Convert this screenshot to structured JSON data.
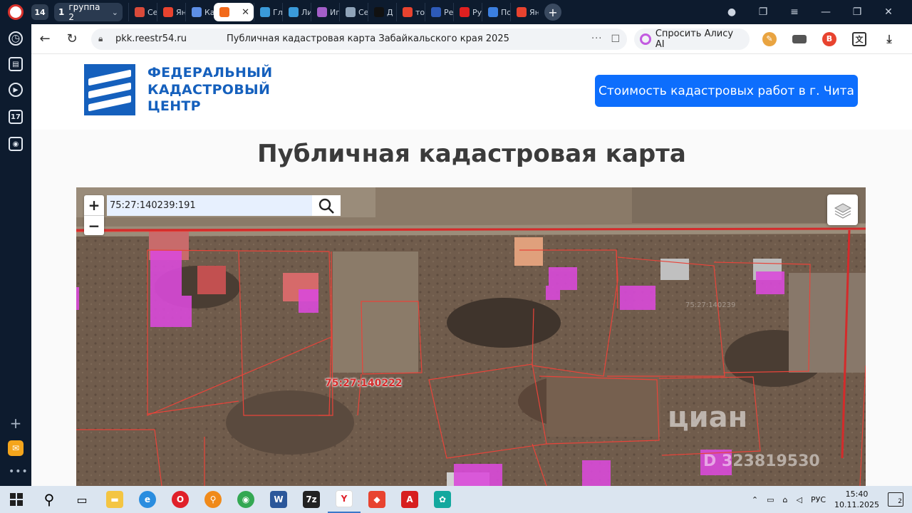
{
  "browser": {
    "tab_count": "14",
    "tab_group": {
      "number": "1",
      "label": "группа 2"
    },
    "tabs": [
      {
        "label": "Се",
        "color": "#d94a3a",
        "icon": "home-icon"
      },
      {
        "label": "Ян",
        "color": "#e8432f",
        "icon": "map-pin-icon"
      },
      {
        "label": "Ка",
        "color": "#5d8fe6",
        "icon": "calc-icon"
      },
      {
        "label": "",
        "color": "#f26a1b",
        "icon": "house-icon",
        "active": true
      },
      {
        "label": "Гл",
        "color": "#3a9ad9",
        "icon": "site-icon"
      },
      {
        "label": "Ли",
        "color": "#3a9ad9",
        "icon": "site-icon"
      },
      {
        "label": "Ип",
        "color": "#a35ec8",
        "icon": "grid-icon"
      },
      {
        "label": "Се",
        "color": "#8fa3b8",
        "icon": "doc-icon"
      },
      {
        "label": "Д",
        "color": "#111111",
        "icon": "star-icon"
      },
      {
        "label": "то",
        "color": "#e8432f",
        "icon": "yandex-icon"
      },
      {
        "label": "Ре",
        "color": "#2d5ab8",
        "icon": "gov-icon"
      },
      {
        "label": "Ру",
        "color": "#e02020",
        "icon": "play-icon"
      },
      {
        "label": "По",
        "color": "#3b7fe0",
        "icon": "mail-icon"
      },
      {
        "label": "Ян",
        "color": "#e8432f",
        "icon": "map-pin-icon"
      }
    ],
    "url_domain": "pkk.reestr54.ru",
    "page_title": "Публичная кадастровая карта Забайкальского края 2025",
    "alice_label": "Спросить Алису AI"
  },
  "site": {
    "logo_lines": [
      "ФЕДЕРАЛЬНЫЙ",
      "КАДАСТРОВЫЙ",
      "ЦЕНТР"
    ],
    "cta_label": "Стоимость кадастровых работ в г. Чита",
    "heading": "Публичная кадастровая карта"
  },
  "map": {
    "zoom_in": "+",
    "zoom_out": "−",
    "search_value": "75:27:140239:191",
    "quarter_label": "75:27:140222",
    "parcel_hint": "75:27:140239",
    "watermark": "циан",
    "watermark_id": "D 323819530",
    "parcel_outline_color": "#e8443a",
    "building_fill_color": "#d94ad9"
  },
  "taskbar": {
    "language": "РУС",
    "time": "15:40",
    "date": "10.11.2025",
    "notifications": "2"
  }
}
